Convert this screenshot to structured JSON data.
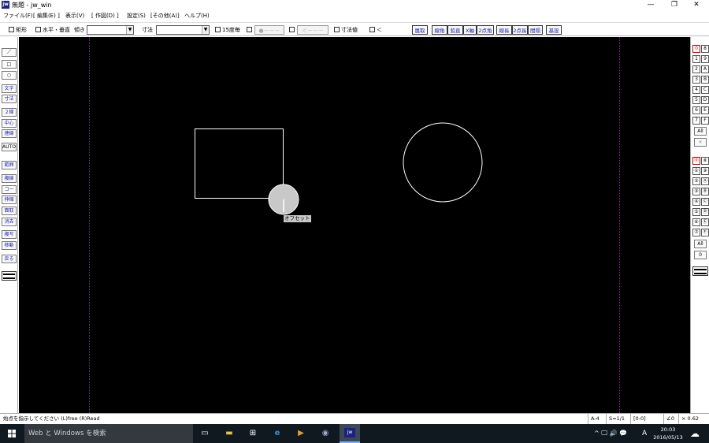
{
  "window": {
    "title": "無題 - jw_win",
    "logo": "jw",
    "controls": {
      "minimize": "—",
      "maximize": "❐",
      "close": "✕"
    }
  },
  "menu": [
    "ファイル(F)",
    "[ 編集(E) ]",
    "表示(V)",
    "[ 作図(D) ]",
    "設定(S)",
    "[その他(A)]",
    "ヘルプ(H)"
  ],
  "toolbar": {
    "rect_label": "矩形",
    "hv_label": "水平・垂直",
    "angle_label": "傾き",
    "angle_value": "",
    "dim_label": "寸法",
    "dim_value": "",
    "deg15_label": "15度毎",
    "btn_dot": "●－－－",
    "btn_arrow": "＜－－－",
    "dim_value_label": "寸法値",
    "lt_label": "＜",
    "cmd_buttons": [
      "属取",
      "線角",
      "鉛直",
      "X軸",
      "2点角",
      "線長",
      "2点長",
      "間隔",
      "基設"
    ]
  },
  "left_tools": [
    "／",
    "□",
    "○",
    "文字",
    "寸法",
    "２線",
    "中心線",
    "連線",
    "AUTO",
    "範囲",
    "複線",
    "コーナー",
    "伸縮",
    "面取",
    "消去",
    "複写",
    "移動",
    "戻る"
  ],
  "canvas": {
    "tooltip": "オフセット",
    "colors": {
      "background": "#000000",
      "lines": "#ffffff",
      "guide": "#8a2b8a",
      "cursor": "#c8c8c8"
    }
  },
  "right_panel": {
    "layer_groups": [
      [
        "0",
        "8"
      ],
      [
        "1",
        "9"
      ],
      [
        "2",
        "A"
      ],
      [
        "3",
        "B"
      ],
      [
        "4",
        "C"
      ],
      [
        "5",
        "D"
      ],
      [
        "6",
        "E"
      ],
      [
        "7",
        "F"
      ]
    ],
    "layers": [
      [
        "⓪",
        "⑧"
      ],
      [
        "①",
        "⑨"
      ],
      [
        "②",
        "Ⓐ"
      ],
      [
        "③",
        "Ⓑ"
      ],
      [
        "④",
        "Ⓒ"
      ],
      [
        "⑤",
        "Ⓓ"
      ],
      [
        "⑥",
        "Ⓔ"
      ],
      [
        "⑦",
        "Ⓕ"
      ]
    ],
    "all_label": "All",
    "x_label": "✕",
    "zero_label": "0"
  },
  "status": {
    "message": "始点を指示してください (L)free (R)Read",
    "paper": "A-4",
    "scale": "S=1/1",
    "layer_info": "[0-0]",
    "angle": "∠0",
    "zoom": "× 0.62"
  },
  "taskbar": {
    "search_placeholder": "Web と Windows を検索",
    "time": "20:03",
    "date": "2016/05/13",
    "ime": "A",
    "tray_icons": "^ 🖵 🔊 💬"
  }
}
